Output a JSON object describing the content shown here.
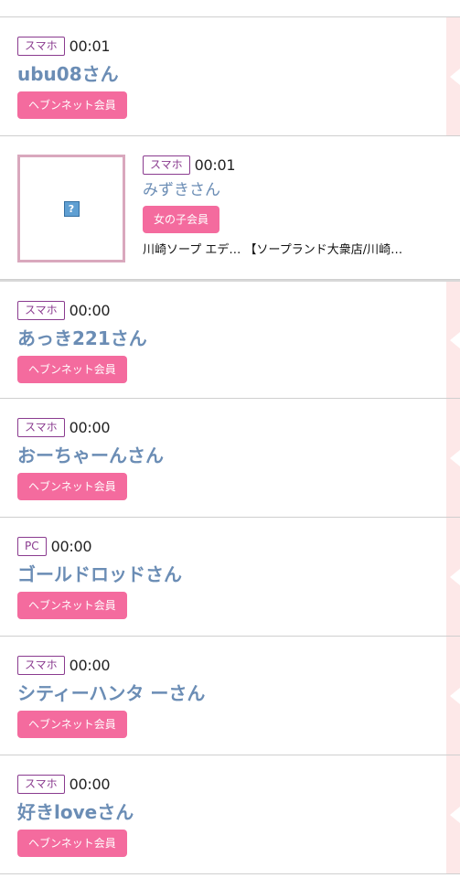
{
  "entries": [
    {
      "device": "スマホ",
      "time": "00:01",
      "name": "ubu08さん",
      "member_type": "ヘブンネット会員"
    },
    {
      "device": "スマホ",
      "time": "00:01",
      "name": "みずきさん",
      "member_type": "女の子会員",
      "shop": "川崎ソープ エデ… 【ソープランド大衆店/川崎…",
      "image_icon": "broken-image-icon"
    },
    {
      "device": "スマホ",
      "time": "00:00",
      "name": "あっき221さん",
      "member_type": "ヘブンネット会員"
    },
    {
      "device": "スマホ",
      "time": "00:00",
      "name": "おーちゃーんさん",
      "member_type": "ヘブンネット会員"
    },
    {
      "device": "PC",
      "time": "00:00",
      "name": "ゴールドロッドさん",
      "member_type": "ヘブンネット会員"
    },
    {
      "device": "スマホ",
      "time": "00:00",
      "name": "シティーハンタ ーさん",
      "member_type": "ヘブンネット会員"
    },
    {
      "device": "スマホ",
      "time": "00:00",
      "name": "好きloveさん",
      "member_type": "ヘブンネット会員"
    }
  ],
  "colors": {
    "name_link": "#6b8db5",
    "device_border": "#8a3b8f",
    "member_badge": "#f46b9e",
    "side_strip": "#fde8e8",
    "thumb_border": "#d9a8bd"
  }
}
